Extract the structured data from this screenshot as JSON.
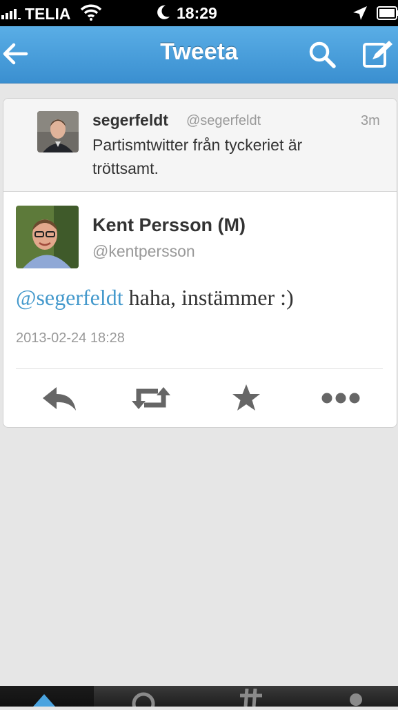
{
  "status_bar": {
    "carrier": "TELIA",
    "time": "18:29"
  },
  "nav": {
    "title": "Tweeta",
    "icons": [
      "back-arrow-icon",
      "search-icon",
      "compose-icon"
    ],
    "accent_color": "#3a8fd0"
  },
  "parent_tweet": {
    "name": "segerfeldt",
    "handle": "@segerfeldt",
    "age": "3m",
    "text": "Partismtwitter från tyckeriet är tröttsamt."
  },
  "main_tweet": {
    "name": "Kent Persson (M)",
    "handle": "@kentpersson",
    "mention": "@segerfeldt",
    "text": "haha, instämmer :)",
    "timestamp": "2013-02-24 18:28",
    "mention_color": "#4499cc"
  },
  "actions": [
    "reply-icon",
    "retweet-icon",
    "favorite-icon",
    "more-icon"
  ],
  "tab_bar": {
    "icons": [
      "home-icon",
      "mentions-icon",
      "discover-icon",
      "profile-icon"
    ],
    "selected": "home-icon"
  }
}
